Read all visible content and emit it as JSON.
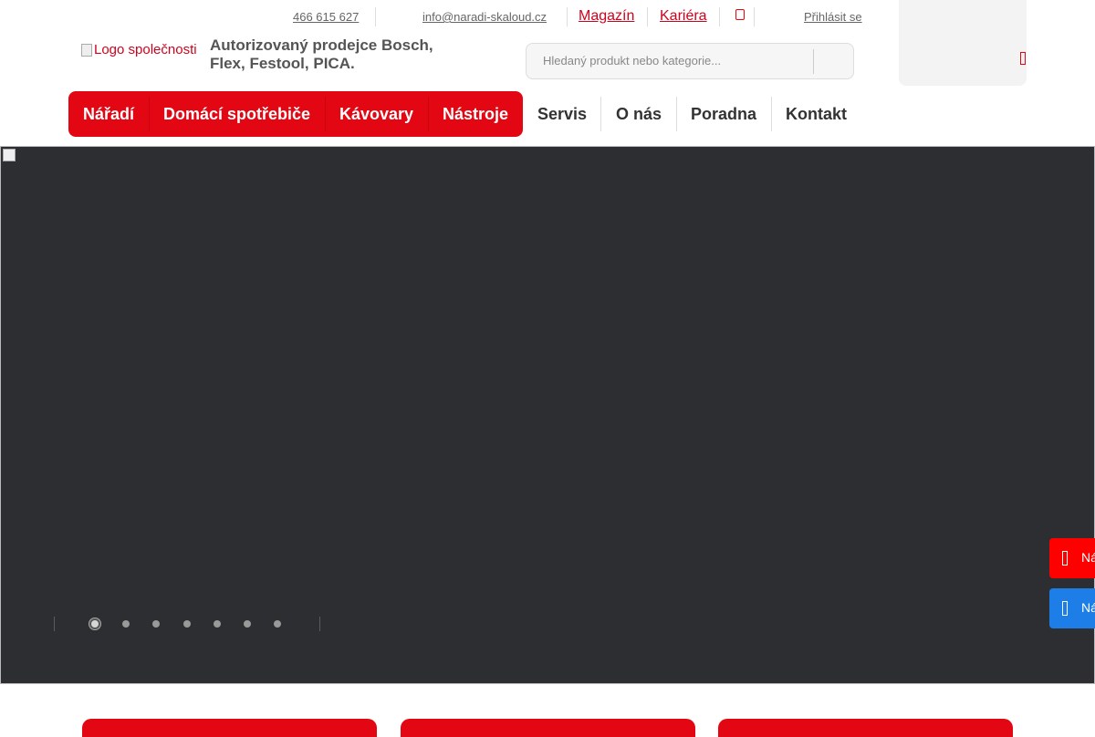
{
  "topbar": {
    "phone": "466 615 627",
    "email": "info@naradi-skaloud.cz",
    "magazine": "Magazín",
    "career": "Kariéra",
    "login": "Přihlásit se"
  },
  "header": {
    "logo_alt": "Logo společnosti",
    "tagline": "Autorizovaný prodejce Bosch, Flex, Festool, PICA."
  },
  "search": {
    "placeholder": "Hledaný produkt nebo kategorie..."
  },
  "nav": {
    "primary": [
      "Nářadí",
      "Domácí spotřebiče",
      "Kávovary",
      "Nástroje"
    ],
    "secondary": [
      "Servis",
      "O nás",
      "Poradna",
      "Kontakt"
    ]
  },
  "hero": {
    "slide_count": 7,
    "active_slide": 1
  },
  "side_buttons": [
    {
      "label": "Ná",
      "color": "#ff0000"
    },
    {
      "label": "Ná",
      "color": "#1e7ee8"
    }
  ],
  "colors": {
    "accent": "#e30613",
    "hero_bg": "#2d2e31"
  }
}
